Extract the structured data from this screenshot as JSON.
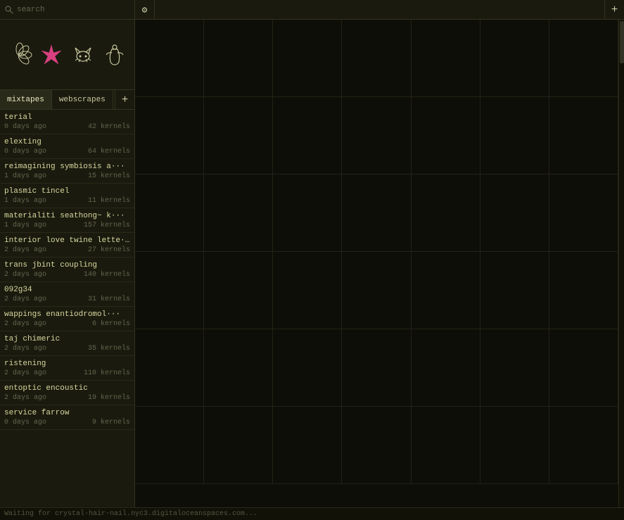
{
  "topbar": {
    "search_placeholder": "search",
    "gear_icon": "⚙",
    "plus_icon": "+"
  },
  "thumbnails": [
    {
      "label": "flower-shape-1"
    },
    {
      "label": "star-shape"
    },
    {
      "label": "cat-shape"
    },
    {
      "label": "figure-shape"
    }
  ],
  "tabs": [
    {
      "label": "mixtapes",
      "active": true
    },
    {
      "label": "webscrapes",
      "active": false
    }
  ],
  "tabs_plus": "+",
  "list_items": [
    {
      "title": "terial",
      "age": "0 days ago",
      "kernels": "42 kernels"
    },
    {
      "title": "elexting",
      "age": "0 days ago",
      "kernels": "64 kernels"
    },
    {
      "title": "reimagining symbiosis a···",
      "age": "1 days ago",
      "kernels": "15 kernels"
    },
    {
      "title": "plasmic tincel",
      "age": "1 days ago",
      "kernels": "11 kernels"
    },
    {
      "title": "materialiti seathong~ k···",
      "age": "1 days ago",
      "kernels": "157 kernels"
    },
    {
      "title": "interior love twine lette···",
      "age": "2 days ago",
      "kernels": "27 kernels"
    },
    {
      "title": "trans jbint coupling",
      "age": "2 days ago",
      "kernels": "140 kernels"
    },
    {
      "title": "092g34",
      "age": "2 days ago",
      "kernels": "31 kernels"
    },
    {
      "title": "wappings enantiodromol···",
      "age": "2 days ago",
      "kernels": "6 kernels"
    },
    {
      "title": "taj chimeric",
      "age": "2 days ago",
      "kernels": "35 kernels"
    },
    {
      "title": "ristening",
      "age": "2 days ago",
      "kernels": "110 kernels"
    },
    {
      "title": "entoptic encoustic",
      "age": "2 days ago",
      "kernels": "19 kernels"
    },
    {
      "title": "service farrow",
      "age": "0 days ago",
      "kernels": "9 kernels"
    }
  ],
  "grid": {
    "columns": 7,
    "rows": 6,
    "total_cells": 42
  },
  "status_bar": {
    "text": "Waiting for crystal-hair-nail.nyc3.digitaloceanspaces.com..."
  }
}
